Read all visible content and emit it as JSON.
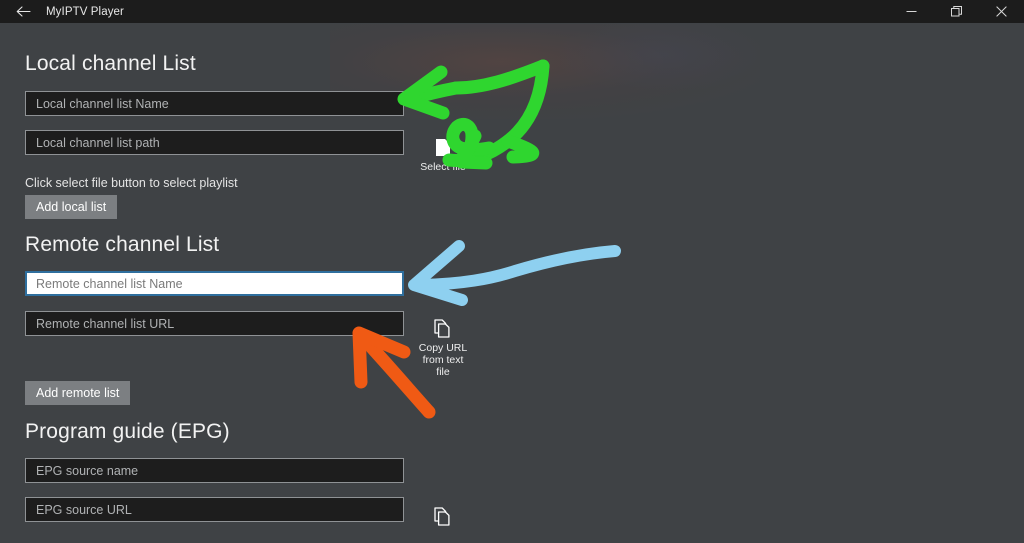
{
  "window": {
    "title": "MyIPTV Player",
    "back_icon": "back-arrow-icon",
    "minimize_label": "Minimize",
    "maximize_label": "Maximize",
    "close_label": "Close"
  },
  "colors": {
    "background": "#3f4245",
    "titlebar": "#1c1c1c",
    "field_background": "#1d1d1d",
    "field_border": "#8f9295",
    "field_focus_border": "#2f6f9e",
    "button_background": "#7c7f82",
    "text": "#f2f2f2",
    "annotation_green": "#2fd62f",
    "annotation_blue": "#8ed0f0",
    "annotation_orange": "#f05a14"
  },
  "sections": {
    "local": {
      "heading": "Local channel List",
      "name_field": {
        "value": "",
        "placeholder": "Local channel list Name"
      },
      "path_field": {
        "value": "",
        "placeholder": "Local channel list path"
      },
      "helper": "Click select file button to select playlist",
      "add_button": "Add local list",
      "select_file": {
        "caption": "Select file",
        "icon": "document-icon"
      }
    },
    "remote": {
      "heading": "Remote channel List",
      "name_field": {
        "value": "",
        "placeholder": "Remote channel list Name",
        "focused": true
      },
      "url_field": {
        "value": "",
        "placeholder": "Remote channel list URL"
      },
      "add_button": "Add remote list",
      "copy_url": {
        "caption": "Copy URL\nfrom text\nfile",
        "icon": "copy-icon"
      }
    },
    "epg": {
      "heading": "Program guide (EPG)",
      "source_name_field": {
        "value": "",
        "placeholder": "EPG source name"
      },
      "source_url_field": {
        "value": "",
        "placeholder": "EPG source URL"
      },
      "copy_url": {
        "caption": "",
        "icon": "copy-icon"
      }
    }
  },
  "annotations": [
    {
      "name": "green-double-arrow",
      "color": "#2fd62f",
      "target": "local name field and select file button"
    },
    {
      "name": "blue-arrow",
      "color": "#8ed0f0",
      "target": "remote channel list name field"
    },
    {
      "name": "orange-arrow",
      "color": "#f05a14",
      "target": "remote channel list url field"
    }
  ]
}
